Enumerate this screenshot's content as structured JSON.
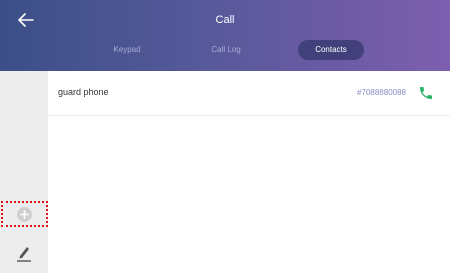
{
  "header": {
    "title": "Call",
    "back_icon": "arrow-left-icon",
    "tabs": [
      {
        "label": "Keypad",
        "active": false
      },
      {
        "label": "Call Log",
        "active": false
      },
      {
        "label": "Contacts",
        "active": true
      }
    ]
  },
  "sidebar": {
    "add_icon": "plus-circle-icon",
    "edit_icon": "pencil-icon",
    "highlight_color": "#e0101a"
  },
  "contacts": [
    {
      "name": "guard phone",
      "number": "#7088880088",
      "call_icon": "phone-icon"
    }
  ],
  "colors": {
    "header_gradient_start": "#3c4f87",
    "header_gradient_end": "#7d5faf",
    "call_icon": "#2bb56a",
    "number_text": "#8a8cc2"
  }
}
